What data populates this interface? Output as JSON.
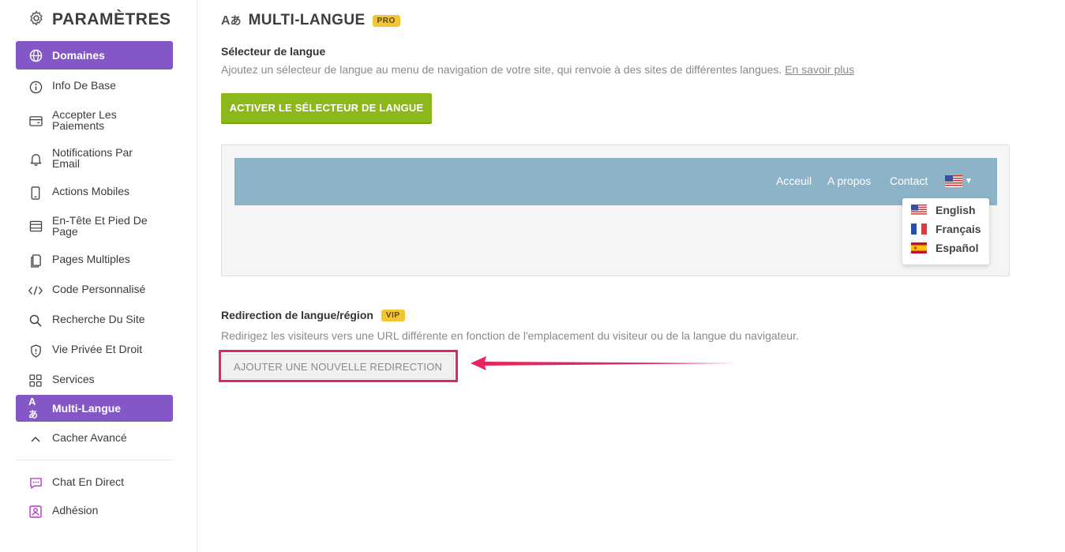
{
  "sidebar": {
    "title": "PARAMÈTRES",
    "items": [
      {
        "label": "Domaines",
        "icon": "globe-icon"
      },
      {
        "label": "Info De Base",
        "icon": "info-icon"
      },
      {
        "label": "Accepter Les Paiements",
        "icon": "wallet-icon"
      },
      {
        "label": "Notifications Par Email",
        "icon": "bell-icon"
      },
      {
        "label": "Actions Mobiles",
        "icon": "mobile-icon"
      },
      {
        "label": "En-Tête Et Pied De Page",
        "icon": "layout-icon"
      },
      {
        "label": "Pages Multiples",
        "icon": "pages-icon"
      },
      {
        "label": "Code Personnalisé",
        "icon": "code-icon"
      },
      {
        "label": "Recherche Du Site",
        "icon": "search-icon"
      },
      {
        "label": "Vie Privée Et Droit",
        "icon": "shield-icon"
      },
      {
        "label": "Services",
        "icon": "grid-icon"
      },
      {
        "label": "Multi-Langue",
        "icon": "translate-icon"
      },
      {
        "label": "Cacher Avancé",
        "icon": "chevron-up-icon"
      },
      {
        "label": "Chat En Direct",
        "icon": "chat-icon"
      },
      {
        "label": "Adhésion",
        "icon": "member-icon"
      }
    ]
  },
  "main": {
    "title": "MULTI-LANGUE",
    "title_badge": "PRO",
    "selector": {
      "heading": "Sélecteur de langue",
      "description": "Ajoutez un sélecteur de langue au menu de navigation de votre site, qui renvoie à des sites de différentes langues.",
      "link": "En savoir plus",
      "button": "ACTIVER LE SÉLECTEUR DE LANGUE"
    },
    "preview": {
      "nav": [
        "Acceuil",
        "A propos",
        "Contact"
      ],
      "languages": [
        "English",
        "Français",
        "Español"
      ]
    },
    "redirect": {
      "heading": "Redirection de langue/région",
      "badge": "VIP",
      "description": "Redirigez les visiteurs vers une URL différente en fonction de l'emplacement du visiteur ou de la langue du navigateur.",
      "button": "AJOUTER UNE NOUVELLE REDIRECTION"
    }
  },
  "colors": {
    "accent_purple": "#8457c6",
    "green_button": "#8cb81b",
    "badge_yellow": "#f3c534",
    "highlight": "#e8245f",
    "nav_bar": "#8db3c9"
  }
}
